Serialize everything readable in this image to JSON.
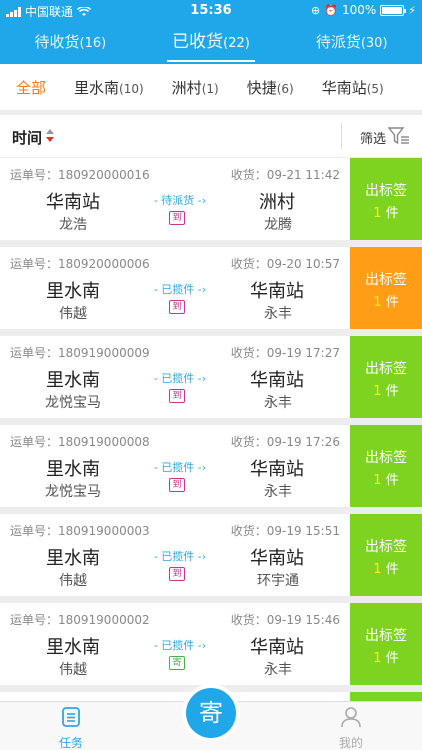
{
  "status_bar": {
    "carrier": "中国联通",
    "time": "15:36",
    "battery": "100%"
  },
  "main_tabs": [
    {
      "label": "待收货",
      "count": "(16)"
    },
    {
      "label": "已收货",
      "count": "(22)"
    },
    {
      "label": "待派货",
      "count": "(30)"
    }
  ],
  "active_main_tab": 1,
  "filter_tabs": [
    {
      "label": "全部",
      "count": ""
    },
    {
      "label": "里水南",
      "count": "(10)"
    },
    {
      "label": "洲村",
      "count": "(1)"
    },
    {
      "label": "快捷",
      "count": "(6)"
    },
    {
      "label": "华南站",
      "count": "(5)"
    }
  ],
  "sort_bar": {
    "sort_label": "时间",
    "filter_label": "筛选"
  },
  "waybills": [
    {
      "no": "运单号：180920000016",
      "recv": "收货：09-21 11:42",
      "from": "华南站",
      "from_person": "龙浩",
      "status": "待派货",
      "tag": "到",
      "to": "洲村",
      "to_person": "龙腾",
      "btn": "出标签",
      "qty": "1",
      "unit": "件"
    },
    {
      "no": "运单号：180920000006",
      "recv": "收货：09-20 10:57",
      "from": "里水南",
      "from_person": "伟越",
      "status": "已揽件",
      "tag": "到",
      "to": "华南站",
      "to_person": "永丰",
      "btn": "出标签",
      "qty": "1",
      "unit": "件"
    },
    {
      "no": "运单号：180919000009",
      "recv": "收货：09-19 17:27",
      "from": "里水南",
      "from_person": "龙悦宝马",
      "status": "已揽件",
      "tag": "到",
      "to": "华南站",
      "to_person": "永丰",
      "btn": "出标签",
      "qty": "1",
      "unit": "件"
    },
    {
      "no": "运单号：180919000008",
      "recv": "收货：09-19 17:26",
      "from": "里水南",
      "from_person": "龙悦宝马",
      "status": "已揽件",
      "tag": "到",
      "to": "华南站",
      "to_person": "永丰",
      "btn": "出标签",
      "qty": "1",
      "unit": "件"
    },
    {
      "no": "运单号：180919000003",
      "recv": "收货：09-19 15:51",
      "from": "里水南",
      "from_person": "伟越",
      "status": "已揽件",
      "tag": "到",
      "to": "华南站",
      "to_person": "环宇通",
      "btn": "出标签",
      "qty": "1",
      "unit": "件"
    },
    {
      "no": "运单号：180919000002",
      "recv": "收货：09-19 15:46",
      "from": "里水南",
      "from_person": "伟越",
      "status": "已揽件",
      "tag": "寄",
      "to": "华南站",
      "to_person": "永丰",
      "btn": "出标签",
      "qty": "1",
      "unit": "件"
    }
  ],
  "tabbar": {
    "task_label": "任务",
    "send_label": "寄",
    "mine_label": "我的"
  },
  "colors": {
    "brand_blue": "#1fa7ea",
    "label_green": "#7ed321",
    "label_orange": "#ff9e16",
    "active_filter": "#f07a1e"
  }
}
